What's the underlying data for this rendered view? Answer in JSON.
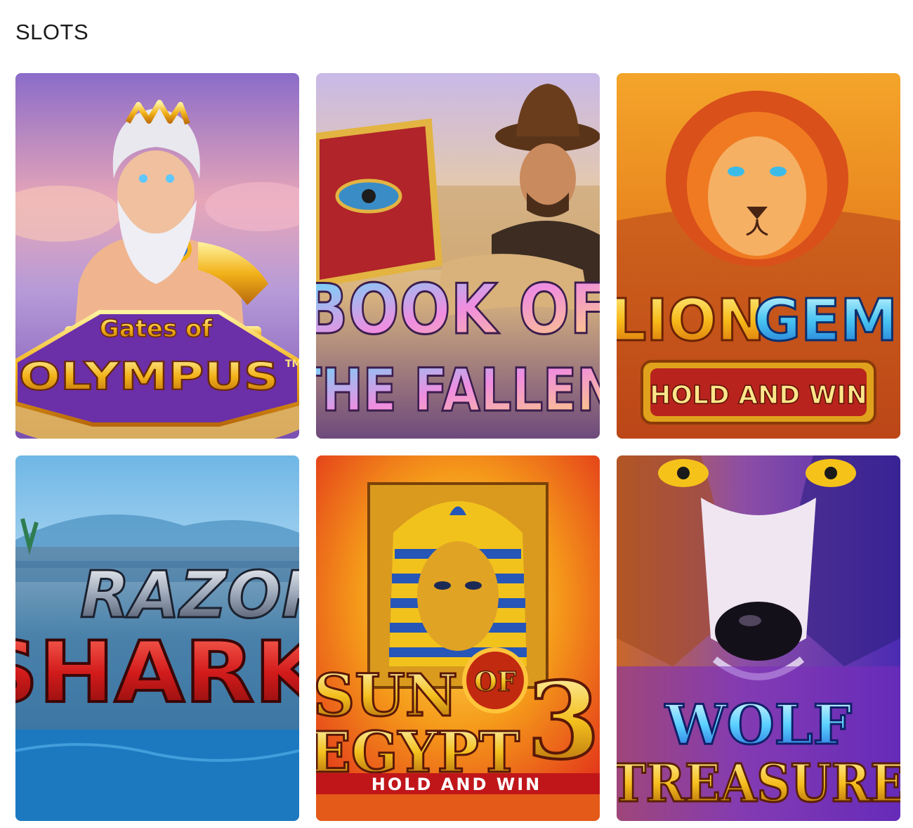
{
  "section": {
    "title": "SLOTS"
  },
  "games": [
    {
      "name": "Gates of Olympus",
      "line1": "Gates of",
      "line2": "OLYMPUS",
      "mark": "TM"
    },
    {
      "name": "Book of the Fallen",
      "line1": "BOOK OF",
      "line2": "THE FALLEN"
    },
    {
      "name": "Lion Gems Hold and Win",
      "line1a": "LION",
      "line1b": "GEMS",
      "badge": "HOLD AND WIN"
    },
    {
      "name": "Razor Shark",
      "line1": "RAZOR",
      "line2": "SHARK"
    },
    {
      "name": "Sun of Egypt 3",
      "line1": "SUN",
      "of": "OF",
      "line2": "EGYPT",
      "number": "3",
      "badge": "HOLD AND WIN"
    },
    {
      "name": "Wolf Treasure",
      "line1": "WOLF",
      "line2": "TREASURE"
    }
  ],
  "colors": {
    "text": "#1a1a1a",
    "background": "#ffffff"
  },
  "icons": [
    "zeus-artwork",
    "explorer-artwork",
    "lion-artwork",
    "shark-artwork",
    "pharaoh-artwork",
    "wolf-artwork"
  ]
}
